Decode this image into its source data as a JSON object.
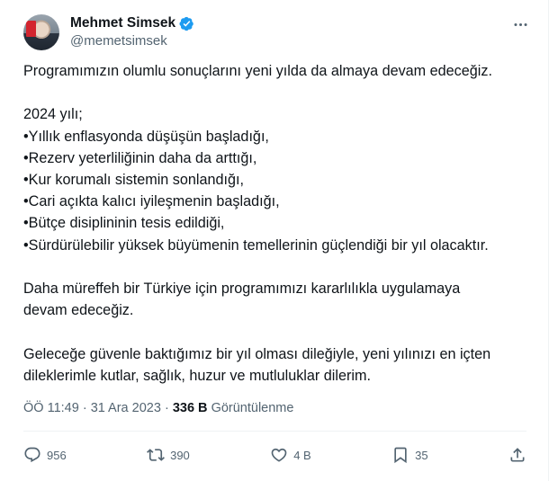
{
  "author": {
    "display_name": "Mehmet Simsek",
    "handle": "@memetsimsek"
  },
  "tweet": {
    "text": "Programımızın olumlu sonuçlarını yeni yılda da almaya devam edeceğiz.\n\n2024 yılı;\n•Yıllık enflasyonda düşüşün başladığı,\n•Rezerv yeterliliğinin daha da arttığı,\n•Kur korumalı sistemin sonlandığı,\n•Cari açıkta kalıcı iyileşmenin başladığı,\n•Bütçe disiplininin tesis edildiği,\n•Sürdürülebilir yüksek büyümenin temellerinin güçlendiği bir yıl olacaktır.\n\nDaha müreffeh bir Türkiye için programımızı kararlılıkla uygulamaya\ndevam edeceğiz.\n\nGeleceğe güvenle baktığımız bir yıl olması dileğiyle, yeni yılınızı en içten\ndileklerimle kutlar, sağlık, huzur ve mutluluklar dilerim.",
    "time": "ÖÖ 11:49",
    "date": "31 Ara 2023",
    "separator": "·",
    "views_count": "336 B",
    "views_label": "Görüntülenme"
  },
  "actions": {
    "replies": "956",
    "reposts": "390",
    "likes": "4 B",
    "bookmarks": "35"
  },
  "colors": {
    "verified": "#1d9bf0",
    "secondary_text": "#536471",
    "divider": "#eff3f4"
  }
}
